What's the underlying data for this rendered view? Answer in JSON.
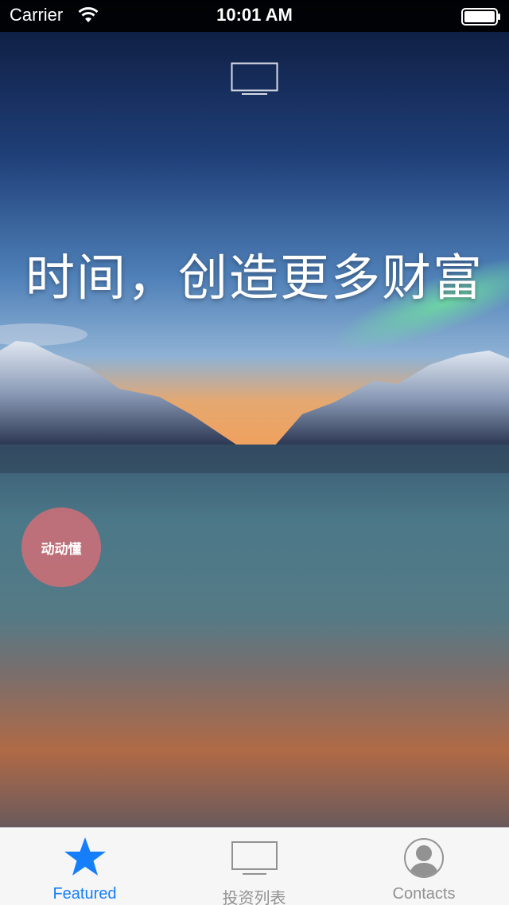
{
  "status_bar": {
    "carrier": "Carrier",
    "time": "10:01 AM"
  },
  "hero": {
    "slogan": "时间，创造更多财富",
    "top_icon": "tv-icon"
  },
  "floating_button": {
    "label": "动动懂",
    "color": "#cd6e78"
  },
  "tab_bar": {
    "accent_color": "#157efb",
    "inactive_color": "#929292",
    "tabs": [
      {
        "label": "Featured",
        "icon": "star-icon",
        "active": true
      },
      {
        "label": "投资列表",
        "icon": "tv-icon",
        "active": false
      },
      {
        "label": "Contacts",
        "icon": "person-icon",
        "active": false
      }
    ]
  }
}
